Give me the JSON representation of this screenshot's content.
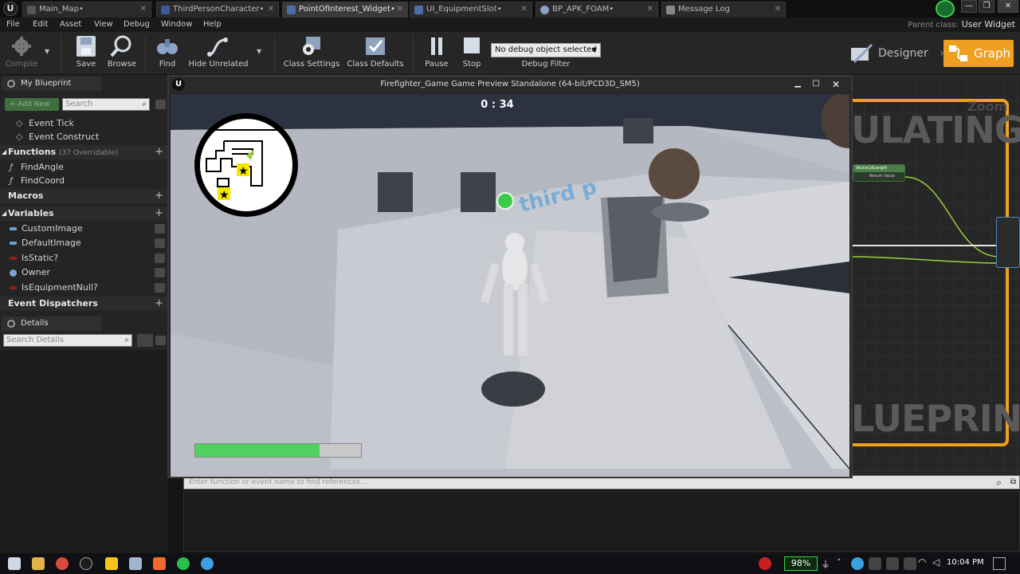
{
  "tabs": [
    {
      "label": "Main_Map•",
      "active": false
    },
    {
      "label": "ThirdPersonCharacter•",
      "active": false
    },
    {
      "label": "PointOfInterest_Widget•",
      "active": true
    },
    {
      "label": "UI_EquipmentSlot•",
      "active": false
    },
    {
      "label": "BP_APK_FOAM•",
      "active": false
    },
    {
      "label": "Message Log",
      "active": false
    }
  ],
  "menu": [
    "File",
    "Edit",
    "Asset",
    "View",
    "Debug",
    "Window",
    "Help"
  ],
  "parent_class": {
    "label": "Parent class:",
    "value": "User Widget"
  },
  "toolbar": {
    "compile": "Compile",
    "save": "Save",
    "browse": "Browse",
    "find": "Find",
    "hide_unrelated": "Hide Unrelated",
    "class_settings": "Class Settings",
    "class_defaults": "Class Defaults",
    "pause": "Pause",
    "stop": "Stop",
    "debug_object": "No debug object selected",
    "debug_filter": "Debug Filter",
    "designer": "Designer",
    "graph": "Graph"
  },
  "my_blueprint": {
    "tab": "My Blueprint",
    "add_new": "+ Add New",
    "search_placeholder": "Search",
    "events": [
      "Event Tick",
      "Event Construct"
    ],
    "functions_label": "Functions",
    "functions_sub": "(37 Overridable)",
    "functions": [
      "FindAngle",
      "FindCoord"
    ],
    "macros_label": "Macros",
    "variables_label": "Variables",
    "variables": [
      {
        "name": "CustomImage",
        "color": "#6fa0c8"
      },
      {
        "name": "DefaultImage",
        "color": "#6fa0c8"
      },
      {
        "name": "IsStatic?",
        "color": "#8a1f1f"
      },
      {
        "name": "Owner",
        "color": "#7e9fd6"
      },
      {
        "name": "IsEquipmentNull?",
        "color": "#8a1f1f"
      }
    ],
    "dispatchers_label": "Event Dispatchers"
  },
  "details": {
    "tab": "Details",
    "search_placeholder": "Search Details"
  },
  "preview": {
    "title": "Firefighter_Game Game Preview Standalone (64-bit/PCD3D_SM5)",
    "timer": "0 : 34",
    "floor_text": "third p",
    "progress": 0.75
  },
  "graph_area": {
    "text_top": "ULATING",
    "text_bottom": "LUEPRINT",
    "zoom": "Zoom",
    "node_title": "Vector2dLength",
    "node_pin": "Return Value"
  },
  "find_results": {
    "placeholder": "Enter function or event name to find references..."
  },
  "taskbar": {
    "battery": "98%",
    "time": "10:04 PM"
  }
}
